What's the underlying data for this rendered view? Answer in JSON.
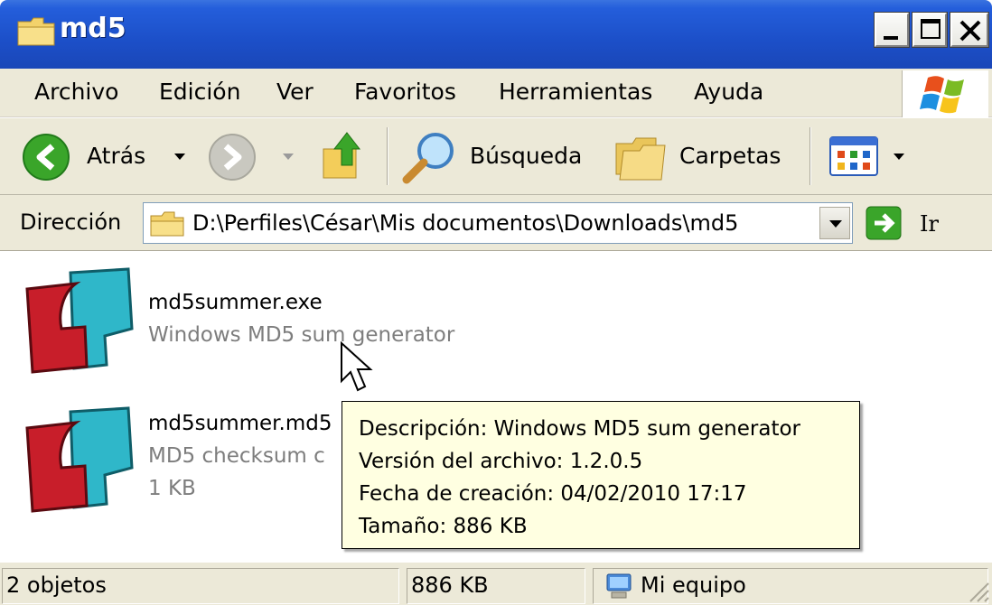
{
  "window": {
    "title": "md5",
    "buttons": {
      "minimize": "_",
      "maximize": "□",
      "close": "X"
    }
  },
  "menu": [
    "Archivo",
    "Edición",
    "Ver",
    "Favoritos",
    "Herramientas",
    "Ayuda"
  ],
  "toolbar": {
    "back_label": "Atrás",
    "search_label": "Búsqueda",
    "folders_label": "Carpetas"
  },
  "address": {
    "label": "Dirección",
    "path": "D:\\Perfiles\\César\\Mis documentos\\Downloads\\md5",
    "go_label": "Ir"
  },
  "files": [
    {
      "name": "md5summer.exe",
      "description": "Windows MD5 sum generator",
      "icon": "md5summer-app-icon"
    },
    {
      "name": "md5summer.md5",
      "description": "MD5 checksum c",
      "size": "1 KB",
      "icon": "md5summer-app-icon"
    }
  ],
  "tooltip": {
    "description": "Descripción: Windows MD5 sum generator",
    "version": "Versión del archivo: 1.2.0.5",
    "created": "Fecha de creación: 04/02/2010 17:17",
    "size": "Tamaño: 886 KB"
  },
  "status": {
    "objects": "2 objetos",
    "size": "886 KB",
    "zone": "Mi equipo"
  },
  "colors": {
    "titlebar": "#245edb",
    "chrome": "#ece9d8",
    "tooltip_bg": "#ffffe1",
    "muted_text": "#7d7d7d"
  }
}
